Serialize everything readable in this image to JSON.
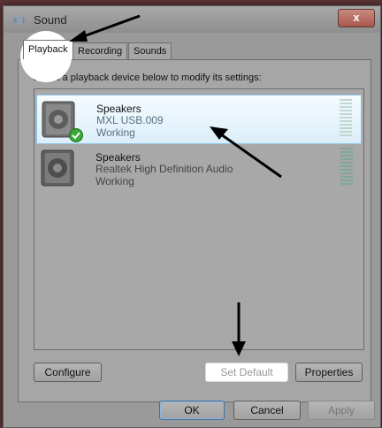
{
  "window": {
    "title": "Sound",
    "close_label": "x"
  },
  "tabs": [
    {
      "label": "Playback",
      "active": true
    },
    {
      "label": "Recording",
      "active": false
    },
    {
      "label": "Sounds",
      "active": false
    }
  ],
  "instruction": "Select a playback device below to modify its settings:",
  "devices": [
    {
      "name": "Speakers",
      "model": "MXL USB.009",
      "status": "Working",
      "selected": true,
      "is_default": true,
      "icon": "speaker-icon"
    },
    {
      "name": "Speakers",
      "model": "Realtek High Definition Audio",
      "status": "Working",
      "selected": false,
      "is_default": false,
      "icon": "speaker-icon"
    }
  ],
  "panel_buttons": {
    "configure": "Configure",
    "set_default": "Set Default",
    "properties": "Properties"
  },
  "dialog_buttons": {
    "ok": "OK",
    "cancel": "Cancel",
    "apply": "Apply"
  },
  "colors": {
    "selection_bg": "#dbeef9",
    "default_check": "#3aa83a"
  }
}
